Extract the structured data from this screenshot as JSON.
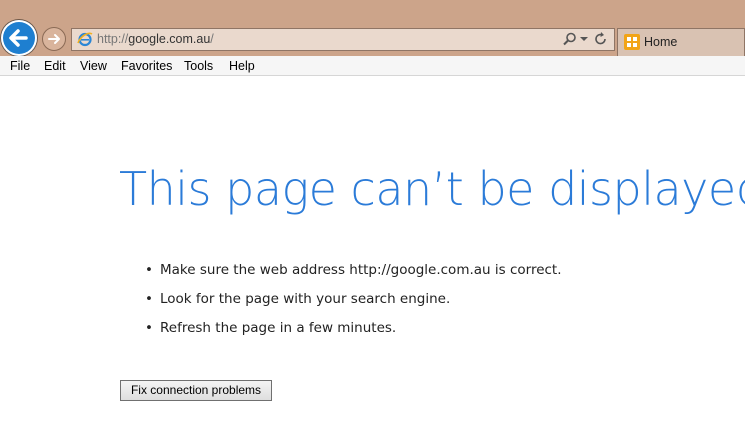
{
  "browser": {
    "address": {
      "protocol": "http://",
      "host": "google.com.au",
      "path": "/"
    },
    "tab": {
      "label": "Home"
    },
    "menu": [
      "File",
      "Edit",
      "View",
      "Favorites",
      "Tools",
      "Help"
    ],
    "colors": {
      "chrome": "#cca48a",
      "back_button": "#1e7fd0"
    }
  },
  "error_page": {
    "title": "This page can’t be displayed",
    "bullet": "•",
    "tips": [
      "Make sure the web address http://google.com.au is correct.",
      "Look for the page with your search engine.",
      "Refresh the page in a few minutes."
    ],
    "fix_button": "Fix connection problems",
    "colors": {
      "title": "#2b7bd8"
    }
  }
}
